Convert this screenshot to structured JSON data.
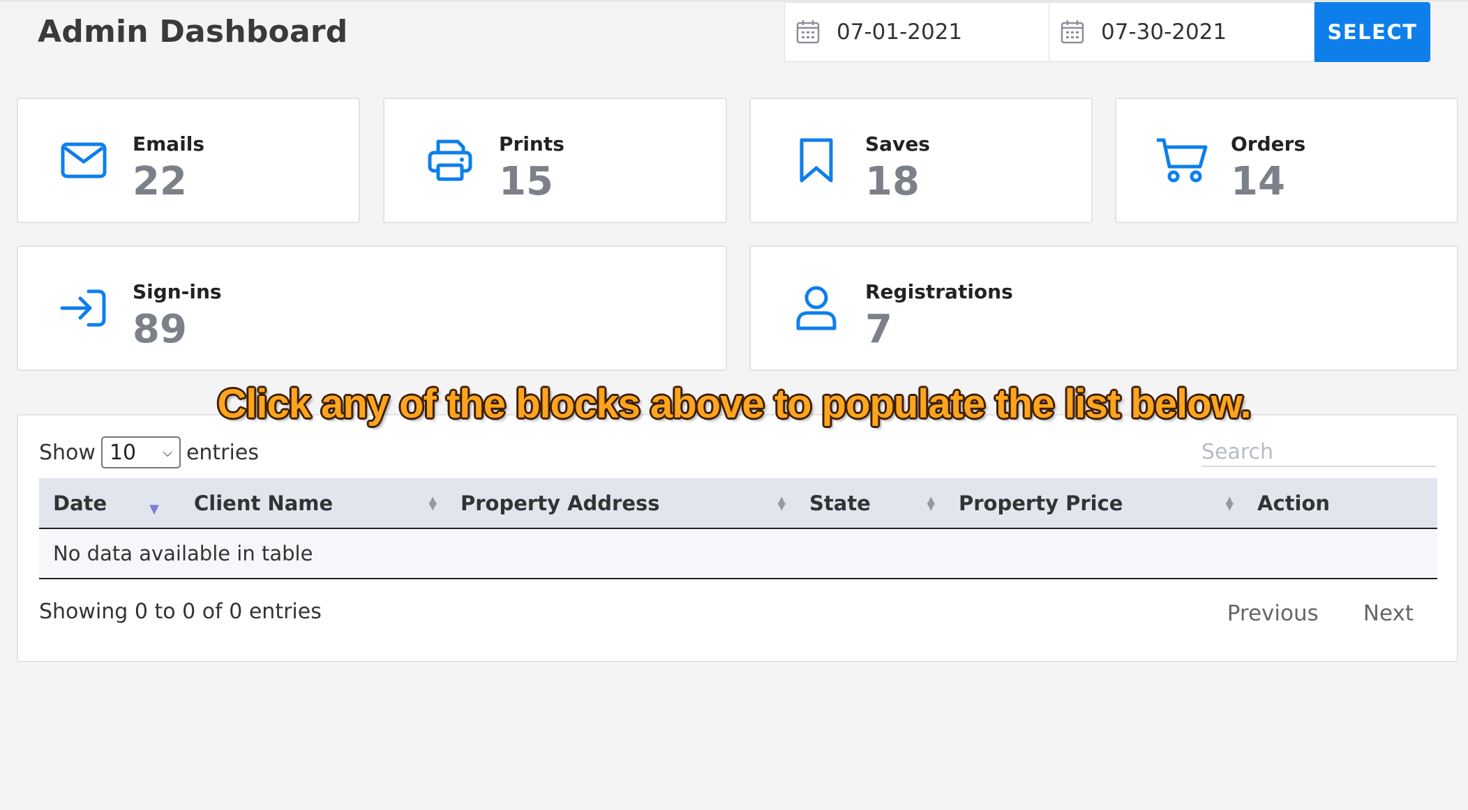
{
  "header": {
    "title": "Admin Dashboard",
    "start_date": "07-01-2021",
    "end_date": "07-30-2021",
    "select_label": "SELECT"
  },
  "stats": [
    {
      "label": "Emails",
      "value": "22",
      "icon": "envelope-icon"
    },
    {
      "label": "Prints",
      "value": "15",
      "icon": "printer-icon"
    },
    {
      "label": "Saves",
      "value": "18",
      "icon": "bookmark-icon"
    },
    {
      "label": "Orders",
      "value": "14",
      "icon": "cart-icon"
    },
    {
      "label": "Sign-ins",
      "value": "89",
      "icon": "sign-in-icon"
    },
    {
      "label": "Registrations",
      "value": "7",
      "icon": "user-icon"
    }
  ],
  "note": "Click any of the blocks above to populate the list below.",
  "table": {
    "show_label": "Show",
    "page_size": "10",
    "entries_label": "entries",
    "search_placeholder": "Search",
    "columns": [
      "Date",
      "Client Name",
      "Property Address",
      "State",
      "Property Price",
      "Action"
    ],
    "empty_message": "No data available in table",
    "info": "Showing 0 to 0 of 0 entries",
    "previous_label": "Previous",
    "next_label": "Next"
  },
  "colors": {
    "accent": "#0e7fea",
    "stat_value": "#7b8089",
    "header_row": "#e1e5ee",
    "note_text": "#ffa41e"
  }
}
